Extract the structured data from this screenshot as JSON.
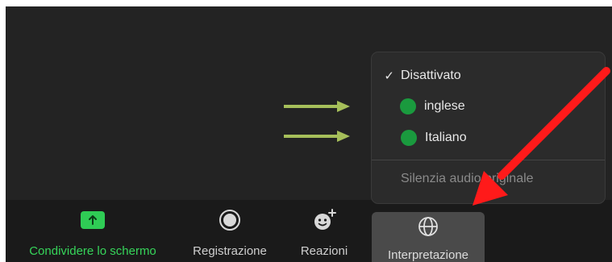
{
  "toolbar": {
    "share_label": "Condividere lo schermo",
    "record_label": "Registrazione",
    "reactions_label": "Reazioni",
    "interpretation_label": "Interpretazione"
  },
  "interpretation_menu": {
    "items": [
      {
        "label": "Disattivato",
        "checked": true
      },
      {
        "label": "inglese",
        "indicator_color": "#1a9a3e"
      },
      {
        "label": "Italiano",
        "indicator_color": "#1a9a3e"
      }
    ],
    "mute_original_label": "Silenzia audio originale"
  },
  "icons": {
    "share": "share-screen-icon",
    "record": "record-icon",
    "reactions": "reactions-icon",
    "interpretation": "globe-icon"
  },
  "colors": {
    "share_accent": "#2fcc55",
    "language_dot": "#1a9a3e",
    "annotation_arrow_green": "#a6bf5a",
    "annotation_arrow_red": "#ff1a1a"
  }
}
